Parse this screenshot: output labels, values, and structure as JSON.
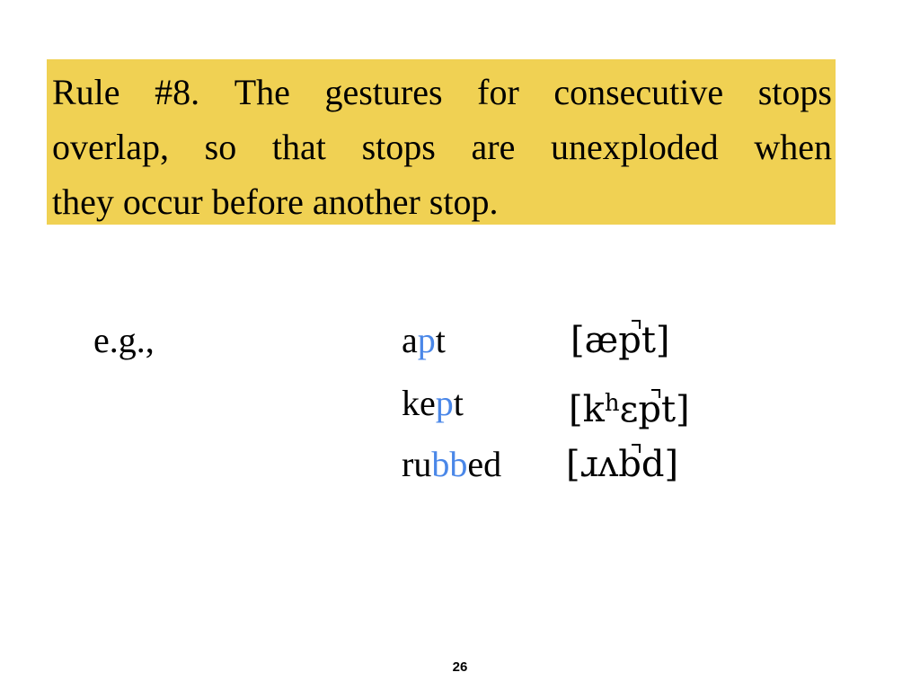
{
  "rule": {
    "line1_words": [
      "Rule",
      "#8.",
      "The",
      "gestures",
      "for",
      "consecutive",
      "stops"
    ],
    "line2_words": [
      "overlap,",
      "so",
      "that",
      "stops",
      "are",
      "unexploded",
      "when"
    ],
    "line3": "they occur before another stop."
  },
  "examples": {
    "intro": "e.g.,",
    "items": [
      {
        "word_parts": [
          "a",
          "p",
          "t"
        ],
        "ipa_parts": [
          "[æ",
          "p",
          "t]"
        ]
      },
      {
        "word_parts": [
          "ke",
          "p",
          "t"
        ],
        "ipa_parts": [
          "[k",
          "h",
          "ɛ",
          "p",
          "t]"
        ]
      },
      {
        "word_parts": [
          "ru",
          "bb",
          "ed"
        ],
        "ipa_parts": [
          "[ɹʌ",
          "b",
          "d]"
        ]
      }
    ]
  },
  "colors": {
    "highlight_box": "#f0d153",
    "stop_highlight": "#4a87e8"
  },
  "page_number": "26"
}
